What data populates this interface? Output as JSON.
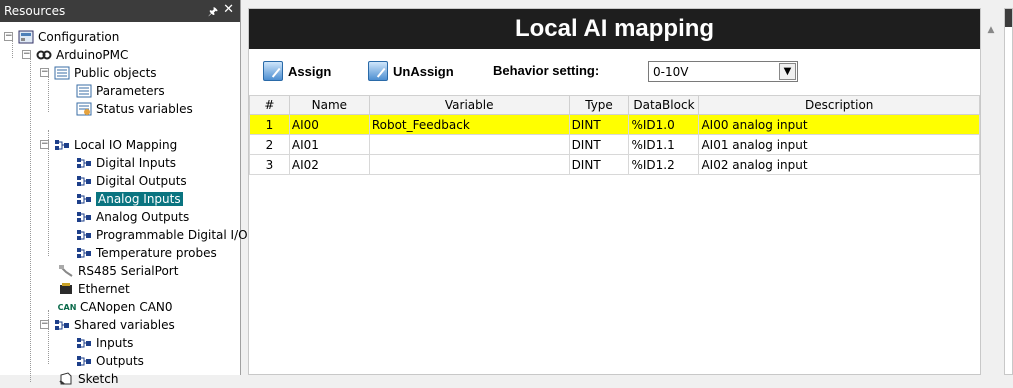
{
  "resources": {
    "title": "Resources",
    "pin_icon": "pin-icon",
    "close_icon": "close-icon",
    "tree": [
      {
        "label": "Configuration",
        "icon": "configuration-icon"
      },
      {
        "label": "ArduinoPMC",
        "icon": "arduino-icon"
      },
      {
        "label": "Public objects",
        "icon": "list-icon"
      },
      {
        "label": "Parameters",
        "icon": "list-icon"
      },
      {
        "label": "Status variables",
        "icon": "status-icon"
      },
      {
        "label": "Local IO Mapping",
        "icon": "io-icon"
      },
      {
        "label": "Digital Inputs",
        "icon": "io-icon"
      },
      {
        "label": "Digital Outputs",
        "icon": "io-icon"
      },
      {
        "label": "Analog Inputs",
        "icon": "io-icon",
        "selected": true
      },
      {
        "label": "Analog Outputs",
        "icon": "io-icon"
      },
      {
        "label": "Programmable Digital I/O",
        "icon": "io-icon"
      },
      {
        "label": "Temperature probes",
        "icon": "io-icon"
      },
      {
        "label": "RS485 SerialPort",
        "icon": "serial-icon"
      },
      {
        "label": "Ethernet",
        "icon": "ethernet-icon"
      },
      {
        "label": "CANopen CAN0",
        "icon": "can-icon",
        "icon_text": "CAN"
      },
      {
        "label": "Shared variables",
        "icon": "io-icon"
      },
      {
        "label": "Inputs",
        "icon": "io-icon"
      },
      {
        "label": "Outputs",
        "icon": "io-icon"
      },
      {
        "label": "Sketch",
        "icon": "sketch-icon"
      }
    ]
  },
  "main": {
    "title": "Local AI mapping",
    "assign_label": "Assign",
    "unassign_label": "UnAssign",
    "behavior_label": "Behavior setting:",
    "behavior_value": "0-10V",
    "table": {
      "headers": [
        "#",
        "Name",
        "Variable",
        "Type",
        "DataBlock",
        "Description"
      ],
      "rows": [
        {
          "idx": "1",
          "name": "AI00",
          "variable": "Robot_Feedback",
          "type": "DINT",
          "datablock": "%ID1.0",
          "description": "AI00 analog input",
          "highlighted": true
        },
        {
          "idx": "2",
          "name": "AI01",
          "variable": "",
          "type": "DINT",
          "datablock": "%ID1.1",
          "description": "AI01 analog input"
        },
        {
          "idx": "3",
          "name": "AI02",
          "variable": "",
          "type": "DINT",
          "datablock": "%ID1.2",
          "description": "AI02 analog input"
        }
      ]
    }
  },
  "colors": {
    "title_bar": "#1e1e1e",
    "selected_node": "#0a7480",
    "row_highlight": "#ffff00"
  }
}
